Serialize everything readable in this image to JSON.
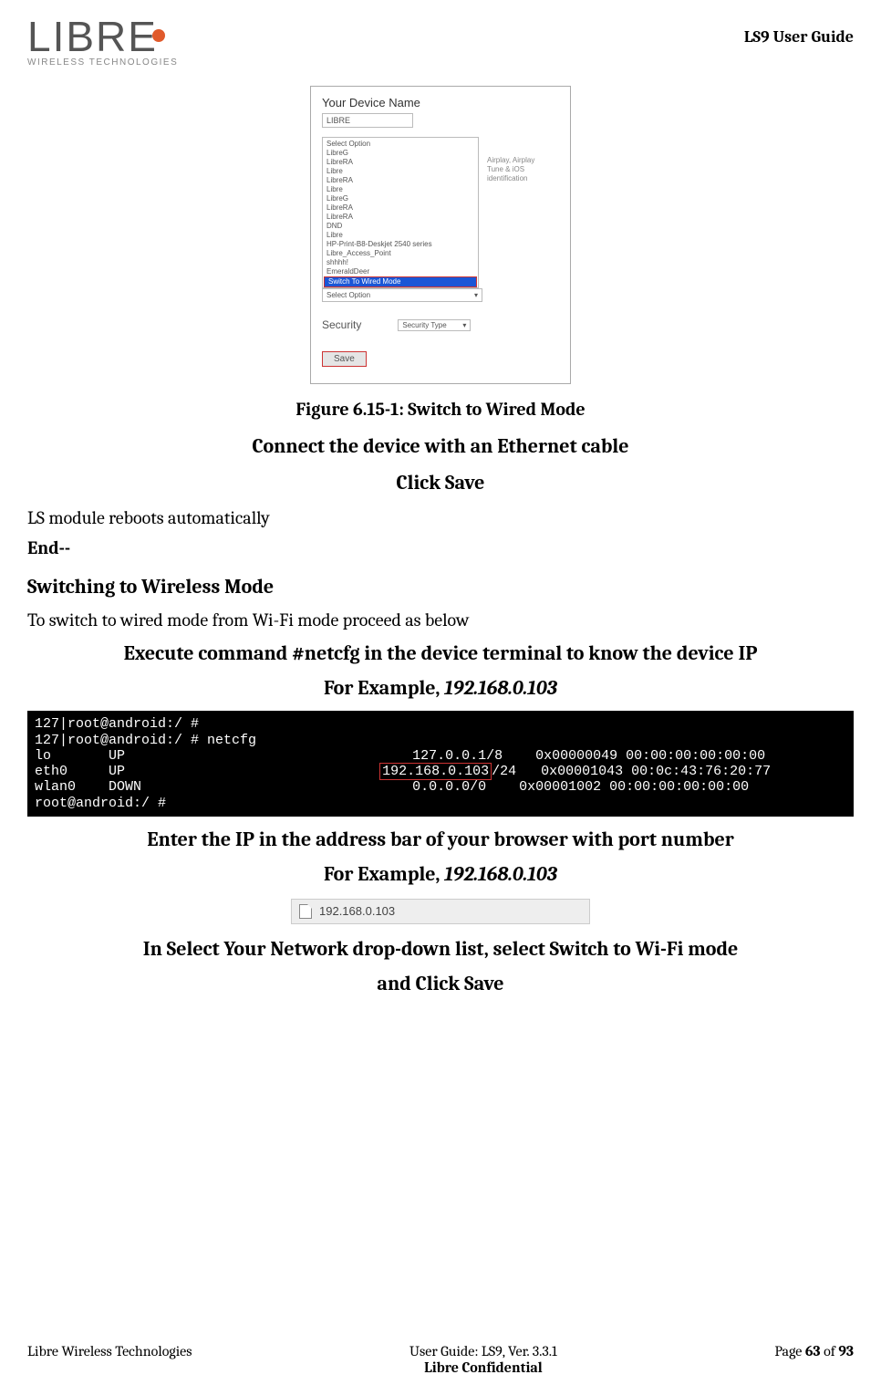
{
  "header": {
    "logo_main": "LIBRE",
    "logo_sub": "WIRELESS TECHNOLOGIES",
    "guide_title": "LS9 User Guide"
  },
  "figure": {
    "device_label": "Your Device Name",
    "device_value": "LIBRE",
    "options": [
      "Select Option",
      "LibreG",
      "LibreRA",
      "Libre",
      "LibreRA",
      "Libre",
      "LibreG",
      "LibreRA",
      "LibreRA",
      "DND",
      "Libre",
      "HP-Print-B8-Deskjet 2540 series",
      "Libre_Access_Point",
      "shhhh!",
      "EmeraldDeer",
      "Switch To Wired Mode"
    ],
    "selected_index": 15,
    "side_hint": "Airplay, Airplay Tune & iOS identification",
    "select_option_label": "Select Option",
    "security_label": "Security",
    "security_type": "Security Type",
    "save_label": "Save"
  },
  "content": {
    "fig_caption": "Figure 6.15-1: Switch to Wired Mode",
    "connect": "Connect the device with an Ethernet cable",
    "click_save": "Click Save",
    "reboot": "LS module reboots automatically",
    "end": "End--",
    "switch_h": "Switching to Wireless Mode",
    "switch_body": "To switch to wired mode from Wi-Fi mode proceed as below",
    "exec_cmd": "Execute command #netcfg in the device terminal to know the device IP",
    "example_prefix": "For Example, ",
    "example_ip": "192.168.0.103",
    "enter_ip": "Enter the IP in the address bar of your browser with port number",
    "select_net_1": "In Select Your Network drop-down list, select ",
    "select_net_italic": "Switch to Wi-Fi mode",
    "and_click": "and Click ",
    "save_italic": "Save"
  },
  "terminal": {
    "l1": "127|root@android:/ #",
    "l2": "127|root@android:/ # netcfg",
    "r1a": "lo       UP                                   ",
    "r1b": "127.0.0.1",
    "r1c": "/8    0x00000049 00:00:00:00:00:00",
    "r2a": "eth0     UP                               ",
    "r2b": "192.168.0.103",
    "r2c": "/24   0x00001043 00:0c:43:76:20:77",
    "r3": "wlan0    DOWN                                 0.0.0.0/0    0x00001002 00:00:00:00:00:00",
    "l6": "root@android:/ #"
  },
  "addr_bar": {
    "url": "192.168.0.103"
  },
  "footer": {
    "left": "Libre Wireless Technologies",
    "center1": "User Guide: LS9, Ver. 3.3.1",
    "center2": "Libre Confidential",
    "page_prefix": "Page ",
    "page_num": "63",
    "page_of": " of ",
    "page_total": "93"
  }
}
